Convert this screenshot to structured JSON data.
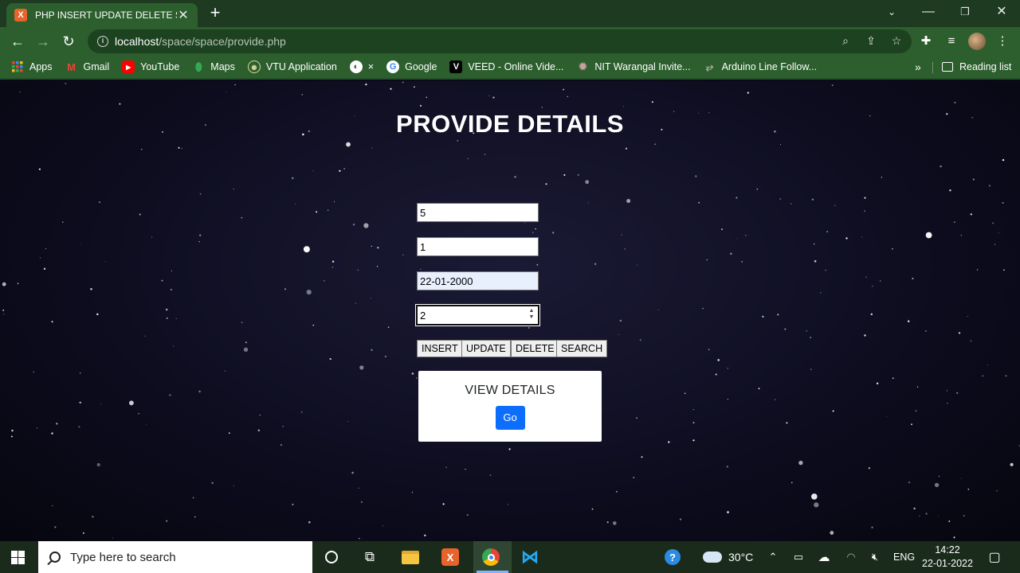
{
  "browser": {
    "tab_title": "PHP INSERT UPDATE DELETE SEA",
    "favicon_label": "X",
    "url_host": "localhost",
    "url_path": "/space/space/provide.php",
    "bookmarks": [
      {
        "label": "Apps",
        "icon": "apps-grid-icon"
      },
      {
        "label": "Gmail",
        "icon": "gmail-icon"
      },
      {
        "label": "YouTube",
        "icon": "youtube-icon"
      },
      {
        "label": "Maps",
        "icon": "maps-icon"
      },
      {
        "label": "VTU Application",
        "icon": "vtu-icon"
      },
      {
        "label": "×",
        "icon": "globe-icon"
      },
      {
        "label": "Google",
        "icon": "google-icon"
      },
      {
        "label": "VEED - Online Vide...",
        "icon": "veed-icon"
      },
      {
        "label": "NIT Warangal Invite...",
        "icon": "nit-icon"
      },
      {
        "label": "Arduino Line Follow...",
        "icon": "arduino-icon"
      }
    ],
    "more_label": "»",
    "reading_list": "Reading list"
  },
  "page": {
    "title": "PROVIDE DETAILS",
    "fields": {
      "field1": "5",
      "field2": "1",
      "date": "22-01-2000",
      "number": "2"
    },
    "buttons": {
      "insert": "INSERT",
      "update": "UPDATE",
      "delete": "DELETE",
      "search": "SEARCH"
    },
    "view_card": {
      "title": "VIEW DETAILS",
      "go_label": "Go"
    }
  },
  "taskbar": {
    "search_placeholder": "Type here to search",
    "temperature": "30°C",
    "language": "ENG",
    "time": "14:22",
    "date": "22-01-2022"
  },
  "colors": {
    "browser_frame": "#2c5f2d",
    "go_button": "#0d6efd",
    "page_bg": "#0d0c1e"
  }
}
